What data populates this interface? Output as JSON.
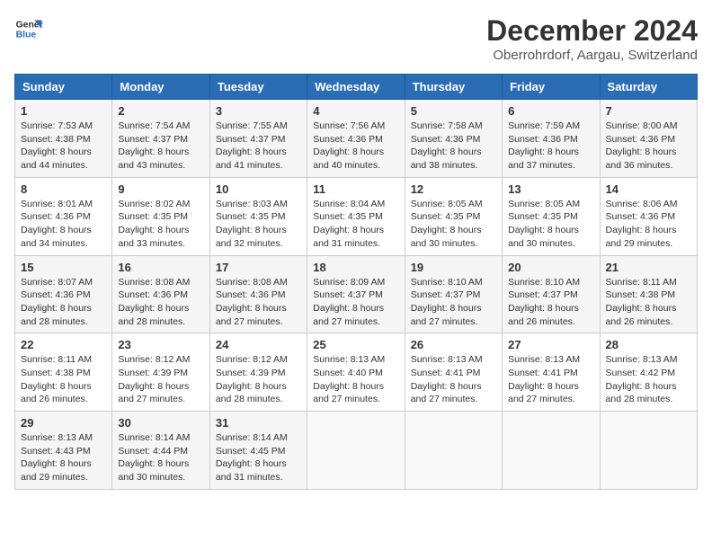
{
  "header": {
    "logo_line1": "General",
    "logo_line2": "Blue",
    "month_title": "December 2024",
    "location": "Oberrohrdorf, Aargau, Switzerland"
  },
  "days_of_week": [
    "Sunday",
    "Monday",
    "Tuesday",
    "Wednesday",
    "Thursday",
    "Friday",
    "Saturday"
  ],
  "weeks": [
    [
      {
        "day": "1",
        "info": "Sunrise: 7:53 AM\nSunset: 4:38 PM\nDaylight: 8 hours\nand 44 minutes."
      },
      {
        "day": "2",
        "info": "Sunrise: 7:54 AM\nSunset: 4:37 PM\nDaylight: 8 hours\nand 43 minutes."
      },
      {
        "day": "3",
        "info": "Sunrise: 7:55 AM\nSunset: 4:37 PM\nDaylight: 8 hours\nand 41 minutes."
      },
      {
        "day": "4",
        "info": "Sunrise: 7:56 AM\nSunset: 4:36 PM\nDaylight: 8 hours\nand 40 minutes."
      },
      {
        "day": "5",
        "info": "Sunrise: 7:58 AM\nSunset: 4:36 PM\nDaylight: 8 hours\nand 38 minutes."
      },
      {
        "day": "6",
        "info": "Sunrise: 7:59 AM\nSunset: 4:36 PM\nDaylight: 8 hours\nand 37 minutes."
      },
      {
        "day": "7",
        "info": "Sunrise: 8:00 AM\nSunset: 4:36 PM\nDaylight: 8 hours\nand 36 minutes."
      }
    ],
    [
      {
        "day": "8",
        "info": "Sunrise: 8:01 AM\nSunset: 4:36 PM\nDaylight: 8 hours\nand 34 minutes."
      },
      {
        "day": "9",
        "info": "Sunrise: 8:02 AM\nSunset: 4:35 PM\nDaylight: 8 hours\nand 33 minutes."
      },
      {
        "day": "10",
        "info": "Sunrise: 8:03 AM\nSunset: 4:35 PM\nDaylight: 8 hours\nand 32 minutes."
      },
      {
        "day": "11",
        "info": "Sunrise: 8:04 AM\nSunset: 4:35 PM\nDaylight: 8 hours\nand 31 minutes."
      },
      {
        "day": "12",
        "info": "Sunrise: 8:05 AM\nSunset: 4:35 PM\nDaylight: 8 hours\nand 30 minutes."
      },
      {
        "day": "13",
        "info": "Sunrise: 8:05 AM\nSunset: 4:35 PM\nDaylight: 8 hours\nand 30 minutes."
      },
      {
        "day": "14",
        "info": "Sunrise: 8:06 AM\nSunset: 4:36 PM\nDaylight: 8 hours\nand 29 minutes."
      }
    ],
    [
      {
        "day": "15",
        "info": "Sunrise: 8:07 AM\nSunset: 4:36 PM\nDaylight: 8 hours\nand 28 minutes."
      },
      {
        "day": "16",
        "info": "Sunrise: 8:08 AM\nSunset: 4:36 PM\nDaylight: 8 hours\nand 28 minutes."
      },
      {
        "day": "17",
        "info": "Sunrise: 8:08 AM\nSunset: 4:36 PM\nDaylight: 8 hours\nand 27 minutes."
      },
      {
        "day": "18",
        "info": "Sunrise: 8:09 AM\nSunset: 4:37 PM\nDaylight: 8 hours\nand 27 minutes."
      },
      {
        "day": "19",
        "info": "Sunrise: 8:10 AM\nSunset: 4:37 PM\nDaylight: 8 hours\nand 27 minutes."
      },
      {
        "day": "20",
        "info": "Sunrise: 8:10 AM\nSunset: 4:37 PM\nDaylight: 8 hours\nand 26 minutes."
      },
      {
        "day": "21",
        "info": "Sunrise: 8:11 AM\nSunset: 4:38 PM\nDaylight: 8 hours\nand 26 minutes."
      }
    ],
    [
      {
        "day": "22",
        "info": "Sunrise: 8:11 AM\nSunset: 4:38 PM\nDaylight: 8 hours\nand 26 minutes."
      },
      {
        "day": "23",
        "info": "Sunrise: 8:12 AM\nSunset: 4:39 PM\nDaylight: 8 hours\nand 27 minutes."
      },
      {
        "day": "24",
        "info": "Sunrise: 8:12 AM\nSunset: 4:39 PM\nDaylight: 8 hours\nand 28 minutes."
      },
      {
        "day": "25",
        "info": "Sunrise: 8:13 AM\nSunset: 4:40 PM\nDaylight: 8 hours\nand 27 minutes."
      },
      {
        "day": "26",
        "info": "Sunrise: 8:13 AM\nSunset: 4:41 PM\nDaylight: 8 hours\nand 27 minutes."
      },
      {
        "day": "27",
        "info": "Sunrise: 8:13 AM\nSunset: 4:41 PM\nDaylight: 8 hours\nand 27 minutes."
      },
      {
        "day": "28",
        "info": "Sunrise: 8:13 AM\nSunset: 4:42 PM\nDaylight: 8 hours\nand 28 minutes."
      }
    ],
    [
      {
        "day": "29",
        "info": "Sunrise: 8:13 AM\nSunset: 4:43 PM\nDaylight: 8 hours\nand 29 minutes."
      },
      {
        "day": "30",
        "info": "Sunrise: 8:14 AM\nSunset: 4:44 PM\nDaylight: 8 hours\nand 30 minutes."
      },
      {
        "day": "31",
        "info": "Sunrise: 8:14 AM\nSunset: 4:45 PM\nDaylight: 8 hours\nand 31 minutes."
      },
      {
        "day": "",
        "info": ""
      },
      {
        "day": "",
        "info": ""
      },
      {
        "day": "",
        "info": ""
      },
      {
        "day": "",
        "info": ""
      }
    ]
  ]
}
